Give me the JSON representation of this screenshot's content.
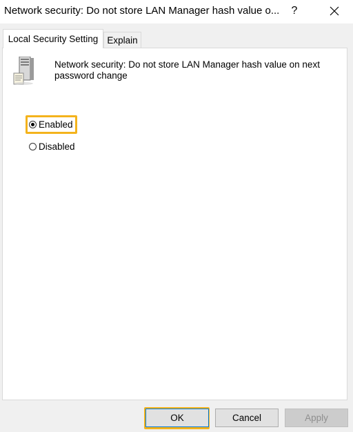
{
  "window": {
    "title": "Network security: Do not store LAN Manager hash value o...",
    "help_label": "?",
    "close_icon": "close-icon"
  },
  "tabs": [
    {
      "label": "Local Security Setting",
      "active": true
    },
    {
      "label": "Explain",
      "active": false
    }
  ],
  "policy": {
    "icon": "server-policy-icon",
    "description": "Network security: Do not store LAN Manager hash value on next password change"
  },
  "options": {
    "enabled_label": "Enabled",
    "disabled_label": "Disabled",
    "selected": "Enabled"
  },
  "buttons": {
    "ok_label": "OK",
    "cancel_label": "Cancel",
    "apply_label": "Apply"
  },
  "colors": {
    "highlight": "#f4b31c",
    "focus_border": "#0078d7"
  }
}
